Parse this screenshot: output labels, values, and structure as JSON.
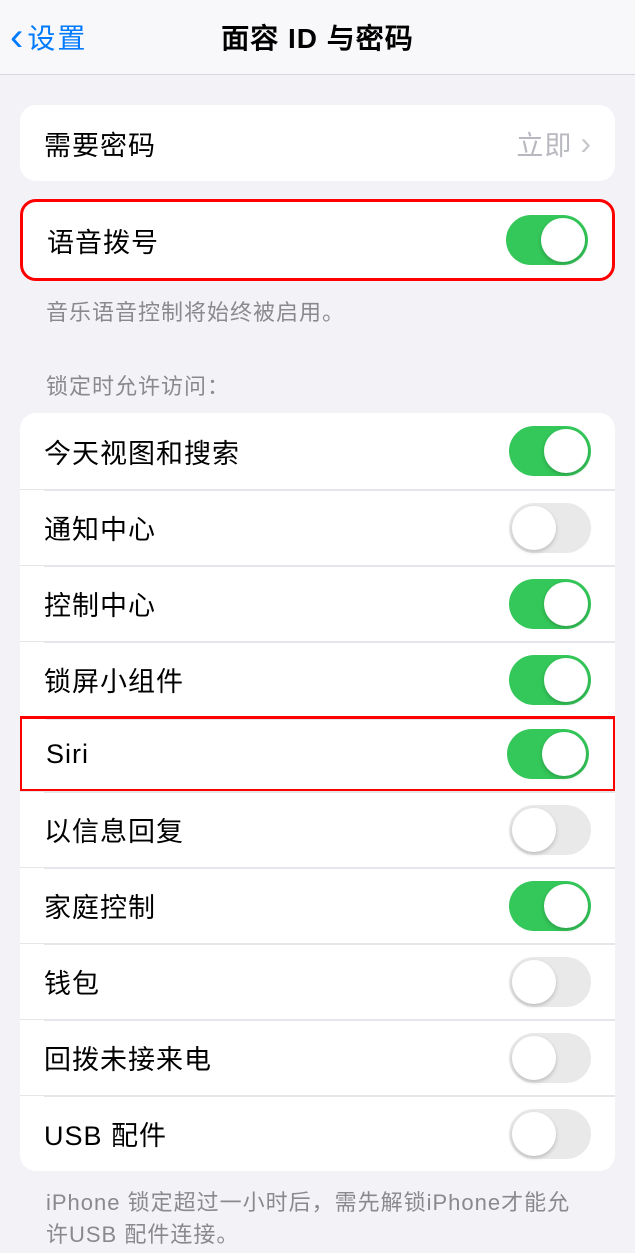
{
  "navbar": {
    "back_label": "设置",
    "title": "面容 ID 与密码"
  },
  "group1": {
    "require_passcode": {
      "label": "需要密码",
      "value": "立即"
    }
  },
  "group2": {
    "voice_dial": {
      "label": "语音拨号",
      "on": true
    },
    "footer": "音乐语音控制将始终被启用。"
  },
  "group3": {
    "header": "锁定时允许访问：",
    "items": [
      {
        "label": "今天视图和搜索",
        "on": true
      },
      {
        "label": "通知中心",
        "on": false
      },
      {
        "label": "控制中心",
        "on": true
      },
      {
        "label": "锁屏小组件",
        "on": true
      },
      {
        "label": "Siri",
        "on": true,
        "highlight": true
      },
      {
        "label": "以信息回复",
        "on": false
      },
      {
        "label": "家庭控制",
        "on": true
      },
      {
        "label": "钱包",
        "on": false
      },
      {
        "label": "回拨未接来电",
        "on": false
      },
      {
        "label": "USB 配件",
        "on": false
      }
    ],
    "footer": "iPhone 锁定超过一小时后，需先解锁iPhone才能允许USB 配件连接。"
  }
}
